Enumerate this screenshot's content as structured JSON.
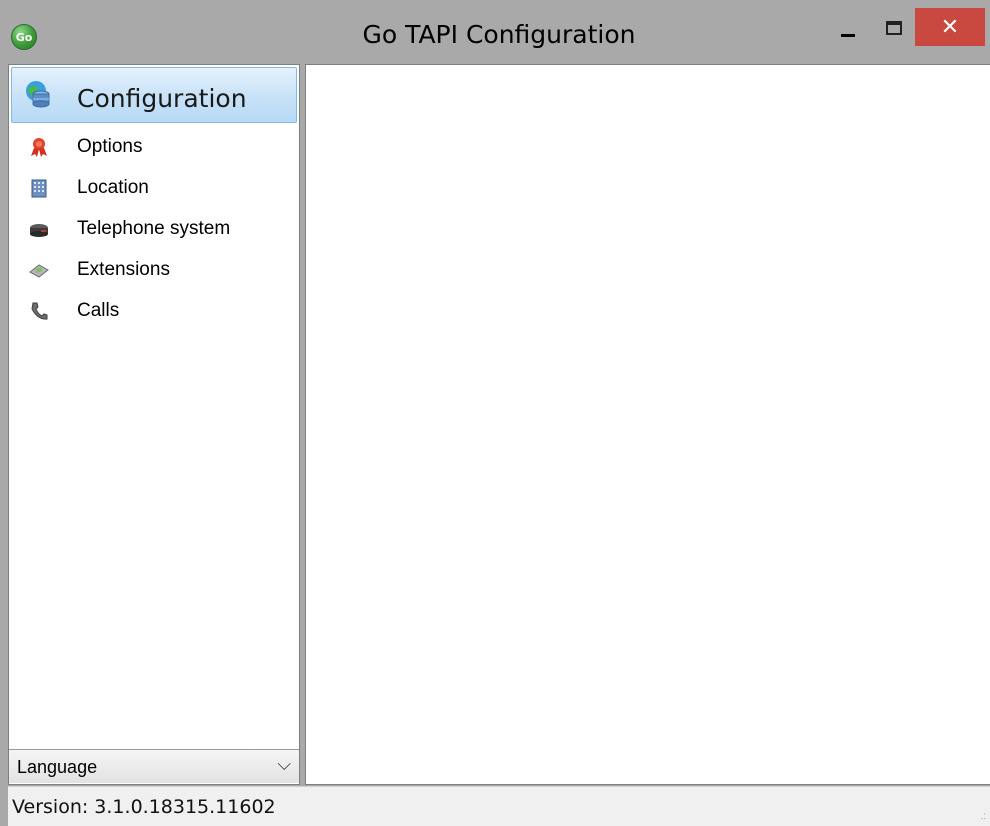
{
  "window": {
    "title": "Go TAPI Configuration",
    "app_icon_text": "Go",
    "close_glyph": "✕"
  },
  "sidebar": {
    "header": {
      "label": "Configuration",
      "icon": "database-globe-icon"
    },
    "items": [
      {
        "label": "Options",
        "icon": "ribbon-award-icon"
      },
      {
        "label": "Location",
        "icon": "building-icon"
      },
      {
        "label": "Telephone system",
        "icon": "phone-system-icon"
      },
      {
        "label": "Extensions",
        "icon": "phone-extension-icon"
      },
      {
        "label": "Calls",
        "icon": "handset-icon"
      }
    ],
    "language": {
      "selected": "Language",
      "chevron": "⌵"
    }
  },
  "statusbar": {
    "version": "Version: 3.1.0.18315.11602",
    "grip": ".:"
  },
  "colors": {
    "title_bg": "#a9a9a9",
    "close_bg": "#c9483f",
    "header_highlight": "#c9e3f8",
    "border": "#7f7f7f"
  }
}
